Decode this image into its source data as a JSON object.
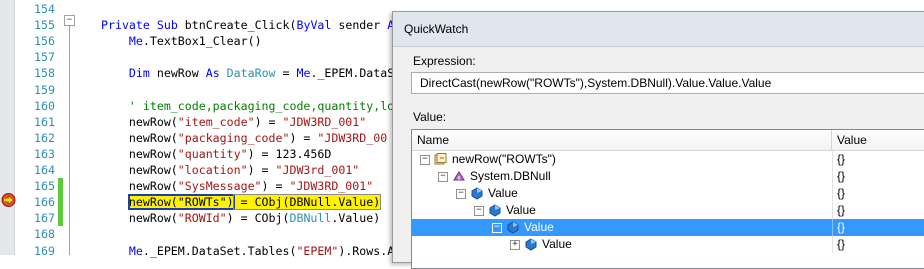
{
  "editor": {
    "lines": [
      {
        "num": "154",
        "code_html": ""
      },
      {
        "num": "155",
        "code_html": "<span class='kw'>Private</span> <span class='kw'>Sub</span> btnCreate_Click(<span class='kw'>ByVal</span> sender <span class='kw'>A</span>"
      },
      {
        "num": "156",
        "code_html": "    <span class='kw'>Me</span>.TextBox1_Clear()"
      },
      {
        "num": "157",
        "code_html": ""
      },
      {
        "num": "158",
        "code_html": "    <span class='kw'>Dim</span> newRow <span class='kw'>As</span> <span class='ty'>DataRow</span> = <span class='kw'>Me</span>._EPEM.DataS"
      },
      {
        "num": "159",
        "code_html": ""
      },
      {
        "num": "160",
        "code_html": "    <span class='cm'>' item_code,packaging_code,quantity,lo</span>"
      },
      {
        "num": "161",
        "code_html": "    newRow(<span class='str'>\"item_code\"</span>) = <span class='str'>\"JDW3RD_001\"</span>"
      },
      {
        "num": "162",
        "code_html": "    newRow(<span class='str'>\"packaging_code\"</span>) = <span class='str'>\"JDW3RD_00</span>"
      },
      {
        "num": "163",
        "code_html": "    newRow(<span class='str'>\"quantity\"</span>) = 123.456D"
      },
      {
        "num": "164",
        "code_html": "    newRow(<span class='str'>\"location\"</span>) = <span class='str'>\"JDW3rd_001\"</span>"
      },
      {
        "num": "165",
        "code_html": "    newRow(<span class='str'>\"SysMessage\"</span>) = <span class='str'>\"JDW3RD_001\"</span>"
      },
      {
        "num": "166",
        "code_html": "    <span class='hl hl-edge'>newRow(\"ROWTs\")</span><span class='hl'> = CObj(DBNull.Value)</span>"
      },
      {
        "num": "167",
        "code_html": "    newRow(<span class='str'>\"ROWId\"</span>) = CObj(<span class='ty'>DBNull</span>.Value)"
      },
      {
        "num": "168",
        "code_html": ""
      },
      {
        "num": "169",
        "code_html": "    <span class='kw'>Me</span>._EPEM.DataSet.Tables(<span class='str'>\"EPEM\"</span>).Rows.A"
      }
    ],
    "outline_toggle": "−"
  },
  "quickwatch": {
    "title": "QuickWatch",
    "expression_label": "Expression:",
    "expression_value": "DirectCast(newRow(\"ROWTs\"),System.DBNull).Value.Value.Value",
    "value_label": "Value:",
    "columns": {
      "name": "Name",
      "value": "Value"
    },
    "rows": [
      {
        "name": "newRow(\"ROWTs\")",
        "value": "{}",
        "toggle": "−",
        "icon": "watch-object-icon"
      },
      {
        "name": "System.DBNull",
        "value": "{}",
        "toggle": "−",
        "icon": "base-class-icon"
      },
      {
        "name": "Value",
        "value": "{}",
        "toggle": "−",
        "icon": "field-icon"
      },
      {
        "name": "Value",
        "value": "{}",
        "toggle": "−",
        "icon": "field-icon"
      },
      {
        "name": "Value",
        "value": "{}",
        "toggle": "−",
        "icon": "field-icon",
        "selected": true
      },
      {
        "name": "Value",
        "value": "{}",
        "toggle": "+",
        "icon": "field-icon"
      }
    ]
  },
  "colors": {
    "highlight": "#fff200",
    "selection": "#3399ff",
    "line_number": "#2b91af",
    "keyword": "#0000ff",
    "string": "#a31515"
  }
}
